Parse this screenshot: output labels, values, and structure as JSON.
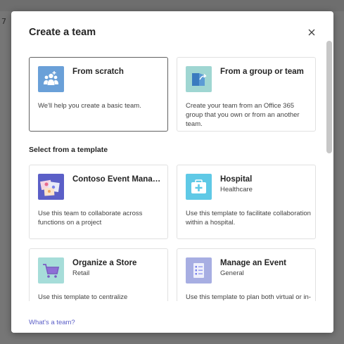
{
  "background": {
    "corner_mark": "7"
  },
  "dialog": {
    "title": "Create a team",
    "close_icon": "close-icon",
    "footer_link": "What's a team?"
  },
  "options": [
    {
      "name": "From scratch",
      "description": "We'll help you create a basic team.",
      "icon": "people-plus-icon",
      "icon_bg": "#6aa0d8",
      "selected": true
    },
    {
      "name": "From a group or team",
      "description": "Create your team from an Office 365 group that you own or from an another team.",
      "icon": "group-share-icon",
      "icon_bg": "#9fd6d2",
      "selected": false
    }
  ],
  "template_section": {
    "label": "Select from a template",
    "templates": [
      {
        "name": "Contoso Event Manag...",
        "subtitle": "",
        "description": "Use this team to collaborate across functions on a project",
        "icon": "event-collage-icon",
        "icon_bg": "#5b5fc7"
      },
      {
        "name": "Hospital",
        "subtitle": "Healthcare",
        "description": "Use this template to facilitate collaboration within a hospital.",
        "icon": "medical-kit-icon",
        "icon_bg": "#5fc9e6"
      },
      {
        "name": "Organize a Store",
        "subtitle": "Retail",
        "description": "Use this template to centralize",
        "icon": "shopping-cart-icon",
        "icon_bg": "#a6ddd9"
      },
      {
        "name": "Manage an Event",
        "subtitle": "General",
        "description": "Use this template to plan both virtual or in-",
        "icon": "checklist-icon",
        "icon_bg": "#a7aee2"
      }
    ]
  },
  "colors": {
    "accent": "#5b5fc7",
    "backdrop": "#767676",
    "selected_border": "#616161"
  }
}
